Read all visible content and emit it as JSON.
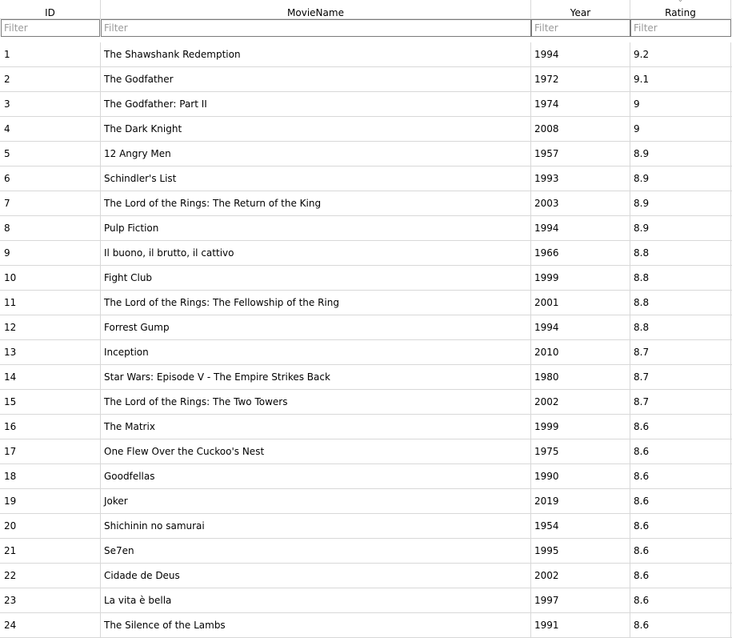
{
  "columns": [
    {
      "key": "id",
      "label": "ID"
    },
    {
      "key": "name",
      "label": "MovieName"
    },
    {
      "key": "year",
      "label": "Year"
    },
    {
      "key": "rating",
      "label": "Rating"
    }
  ],
  "sort_indicator": "⌄",
  "filter_placeholder": "Filter",
  "rows": [
    {
      "id": "1",
      "name": "The Shawshank Redemption",
      "year": "1994",
      "rating": "9.2"
    },
    {
      "id": "2",
      "name": "The Godfather",
      "year": "1972",
      "rating": "9.1"
    },
    {
      "id": "3",
      "name": "The Godfather: Part II",
      "year": "1974",
      "rating": "9"
    },
    {
      "id": "4",
      "name": "The Dark Knight",
      "year": "2008",
      "rating": "9"
    },
    {
      "id": "5",
      "name": "12 Angry Men",
      "year": "1957",
      "rating": "8.9"
    },
    {
      "id": "6",
      "name": "Schindler's List",
      "year": "1993",
      "rating": "8.9"
    },
    {
      "id": "7",
      "name": "The Lord of the Rings: The Return of the King",
      "year": "2003",
      "rating": "8.9"
    },
    {
      "id": "8",
      "name": "Pulp Fiction",
      "year": "1994",
      "rating": "8.9"
    },
    {
      "id": "9",
      "name": "Il buono, il brutto, il cattivo",
      "year": "1966",
      "rating": "8.8"
    },
    {
      "id": "10",
      "name": "Fight Club",
      "year": "1999",
      "rating": "8.8"
    },
    {
      "id": "11",
      "name": "The Lord of the Rings: The Fellowship of the Ring",
      "year": "2001",
      "rating": "8.8"
    },
    {
      "id": "12",
      "name": "Forrest Gump",
      "year": "1994",
      "rating": "8.8"
    },
    {
      "id": "13",
      "name": "Inception",
      "year": "2010",
      "rating": "8.7"
    },
    {
      "id": "14",
      "name": "Star Wars: Episode V - The Empire Strikes Back",
      "year": "1980",
      "rating": "8.7"
    },
    {
      "id": "15",
      "name": "The Lord of the Rings: The Two Towers",
      "year": "2002",
      "rating": "8.7"
    },
    {
      "id": "16",
      "name": "The Matrix",
      "year": "1999",
      "rating": "8.6"
    },
    {
      "id": "17",
      "name": "One Flew Over the Cuckoo's Nest",
      "year": "1975",
      "rating": "8.6"
    },
    {
      "id": "18",
      "name": "Goodfellas",
      "year": "1990",
      "rating": "8.6"
    },
    {
      "id": "19",
      "name": "Joker",
      "year": "2019",
      "rating": "8.6"
    },
    {
      "id": "20",
      "name": "Shichinin no samurai",
      "year": "1954",
      "rating": "8.6"
    },
    {
      "id": "21",
      "name": "Se7en",
      "year": "1995",
      "rating": "8.6"
    },
    {
      "id": "22",
      "name": "Cidade de Deus",
      "year": "2002",
      "rating": "8.6"
    },
    {
      "id": "23",
      "name": "La vita è bella",
      "year": "1997",
      "rating": "8.6"
    },
    {
      "id": "24",
      "name": "The Silence of the Lambs",
      "year": "1991",
      "rating": "8.6"
    }
  ]
}
